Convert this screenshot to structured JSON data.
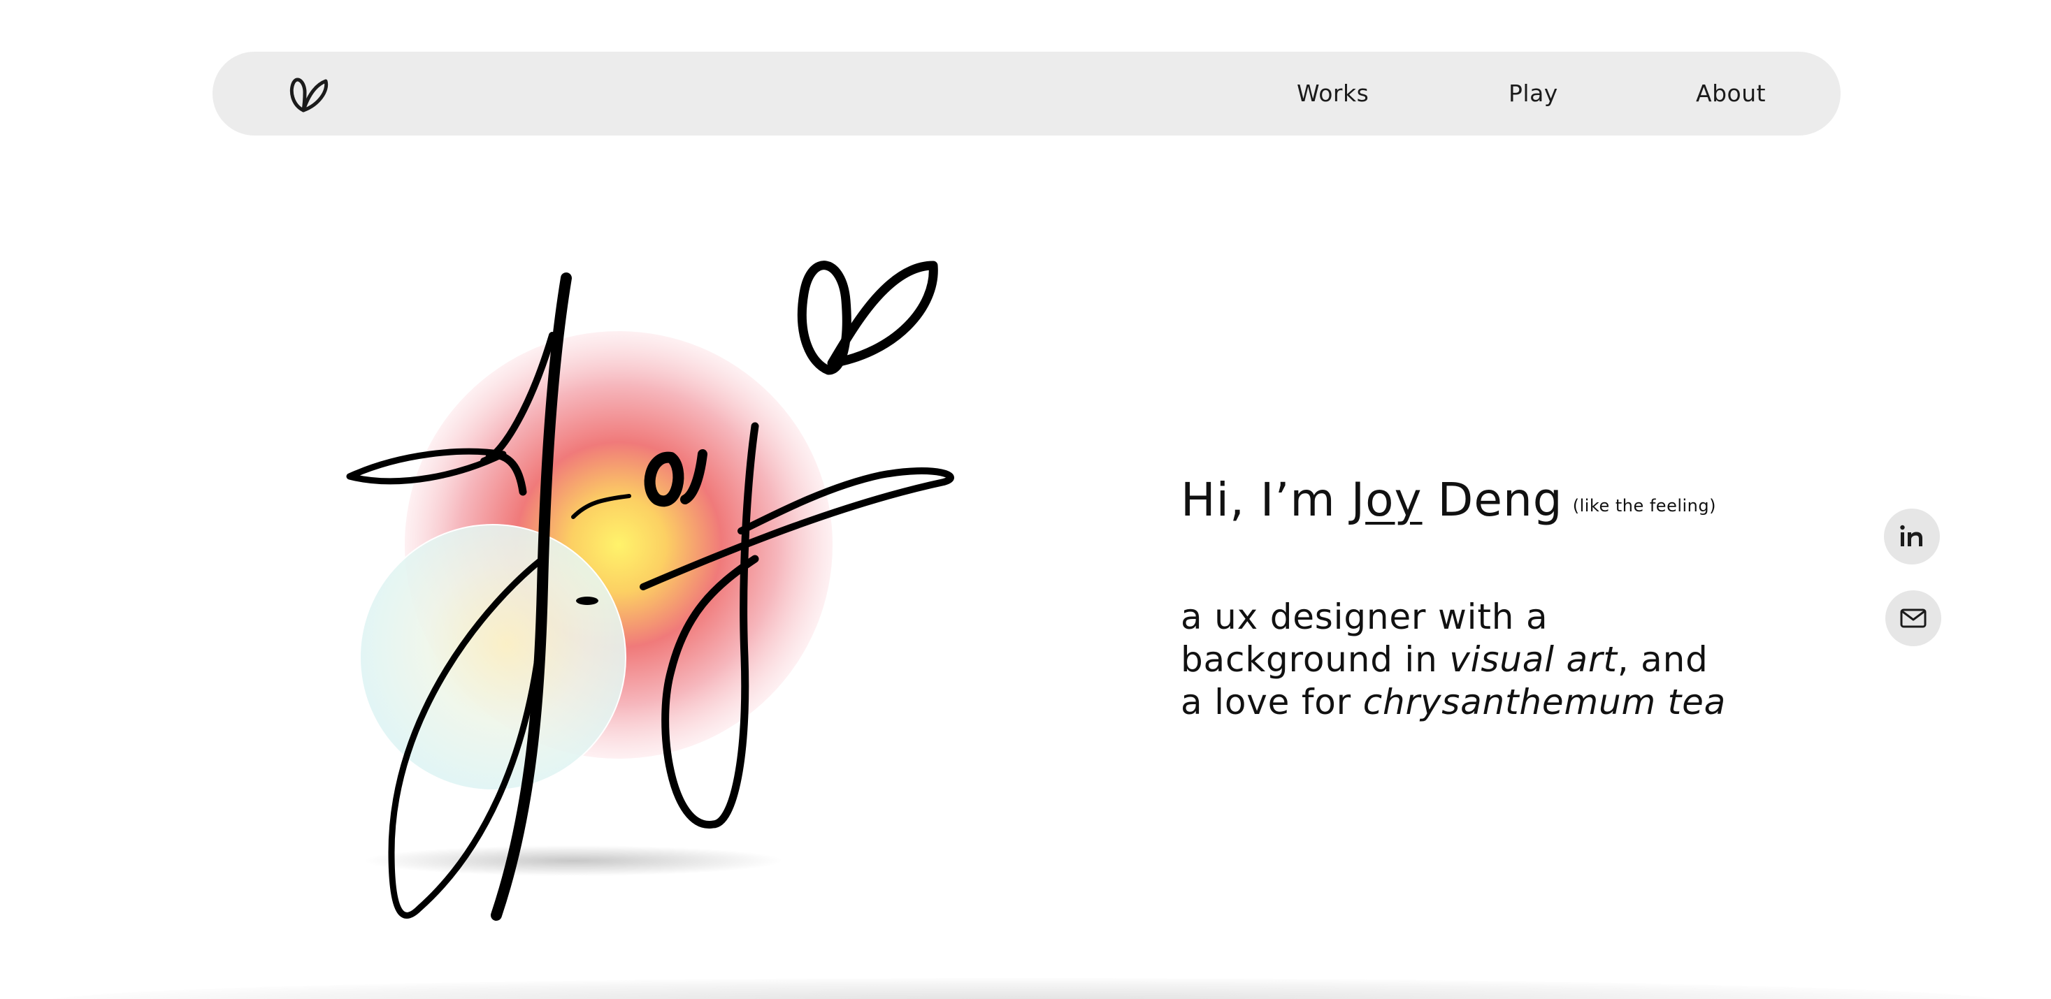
{
  "nav": {
    "logo_icon": "leaf-heart-logo-icon",
    "items": [
      {
        "label": "Works"
      },
      {
        "label": "Play"
      },
      {
        "label": "About"
      }
    ]
  },
  "hero": {
    "signature_image": "Joy signature with heart and gradient circles",
    "greeting_prefix": "Hi, I’m ",
    "name_first_start": "J",
    "name_first_underlined": "oy",
    "name_last": " Deng",
    "name_aside": "(like the feeling)",
    "bio_part1": "a ux designer with a background in ",
    "bio_em1": "visual art",
    "bio_part2": ", and a love for ",
    "bio_em2": "chrysanthemum tea"
  },
  "social": {
    "linkedin_icon": "linkedin-icon",
    "mail_icon": "mail-icon"
  },
  "colors": {
    "nav_bg": "#ececec",
    "text": "#111111",
    "gradient_center": "#fff36b",
    "gradient_mid": "#f07a7a",
    "bubble_tint": "#dff4f4"
  }
}
